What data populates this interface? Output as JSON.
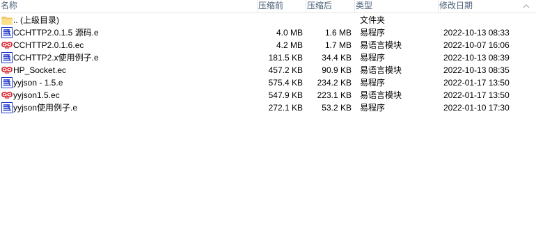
{
  "columns": {
    "name": "名称",
    "size": "压缩前",
    "packed": "压缩后",
    "type": "类型",
    "modified": "修改日期"
  },
  "files": [
    {
      "name": ".. (上级目录)",
      "size": "",
      "packed": "",
      "type": "文件夹",
      "modified": "",
      "icon": "folder-icon"
    },
    {
      "name": "CCHTTP2.0.1.5 源码.e",
      "size": "4.0 MB",
      "packed": "1.6 MB",
      "type": "易程序",
      "modified": "2022-10-13 08:33",
      "icon": "e-source-icon"
    },
    {
      "name": "CCHTTP2.0.1.6.ec",
      "size": "4.2 MB",
      "packed": "1.7 MB",
      "type": "易语言模块",
      "modified": "2022-10-07 16:06",
      "icon": "e-module-icon"
    },
    {
      "name": "CCHTTP2.x使用例子.e",
      "size": "181.5 KB",
      "packed": "34.4 KB",
      "type": "易程序",
      "modified": "2022-10-13 08:39",
      "icon": "e-source-icon"
    },
    {
      "name": "HP_Socket.ec",
      "size": "457.2 KB",
      "packed": "90.9 KB",
      "type": "易语言模块",
      "modified": "2022-10-13 08:35",
      "icon": "e-module-icon"
    },
    {
      "name": "yyjson - 1.5.e",
      "size": "575.4 KB",
      "packed": "234.2 KB",
      "type": "易程序",
      "modified": "2022-01-17 13:50",
      "icon": "e-source-icon"
    },
    {
      "name": "yyjson1.5.ec",
      "size": "547.9 KB",
      "packed": "223.1 KB",
      "type": "易语言模块",
      "modified": "2022-01-17 13:50",
      "icon": "e-module-icon"
    },
    {
      "name": "yyjson使用例子.e",
      "size": "272.1 KB",
      "packed": "53.2 KB",
      "type": "易程序",
      "modified": "2022-01-10 17:30",
      "icon": "e-source-icon"
    }
  ]
}
